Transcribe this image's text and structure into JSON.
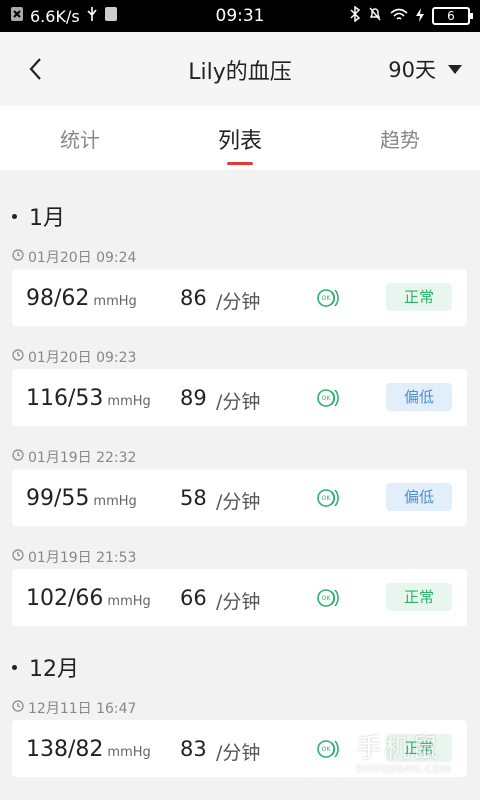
{
  "status_bar": {
    "network_speed": "6.6K/s",
    "time": "09:31",
    "battery": "6"
  },
  "header": {
    "title": "Lily的血压",
    "range": "90天"
  },
  "tabs": [
    {
      "label": "统计",
      "active": false
    },
    {
      "label": "列表",
      "active": true
    },
    {
      "label": "趋势",
      "active": false
    }
  ],
  "groups": [
    {
      "month": "1月",
      "records": [
        {
          "time": "01月20日 09:24",
          "bp": "98/62",
          "unit": "mmHg",
          "pulse": "86",
          "pulse_unit": "/分钟",
          "status": "正常",
          "status_type": "normal"
        },
        {
          "time": "01月20日 09:23",
          "bp": "116/53",
          "unit": "mmHg",
          "pulse": "89",
          "pulse_unit": "/分钟",
          "status": "偏低",
          "status_type": "low"
        },
        {
          "time": "01月19日 22:32",
          "bp": "99/55",
          "unit": "mmHg",
          "pulse": "58",
          "pulse_unit": "/分钟",
          "status": "偏低",
          "status_type": "low"
        },
        {
          "time": "01月19日 21:53",
          "bp": "102/66",
          "unit": "mmHg",
          "pulse": "66",
          "pulse_unit": "/分钟",
          "status": "正常",
          "status_type": "normal"
        }
      ]
    },
    {
      "month": "12月",
      "records": [
        {
          "time": "12月11日 16:47",
          "bp": "138/82",
          "unit": "mmHg",
          "pulse": "83",
          "pulse_unit": "/分钟",
          "status": "正常",
          "status_type": "normal"
        }
      ]
    }
  ],
  "watermark": {
    "main": "手机鼠",
    "sub": "SHOUJISHU.COM"
  },
  "colors": {
    "accent": "#e53935",
    "normal_badge_bg": "#e8f6ee",
    "normal_badge_text": "#2bb36b",
    "low_badge_bg": "#e2eefa",
    "low_badge_text": "#4a90d9",
    "ok_icon": "#2bb36b"
  }
}
